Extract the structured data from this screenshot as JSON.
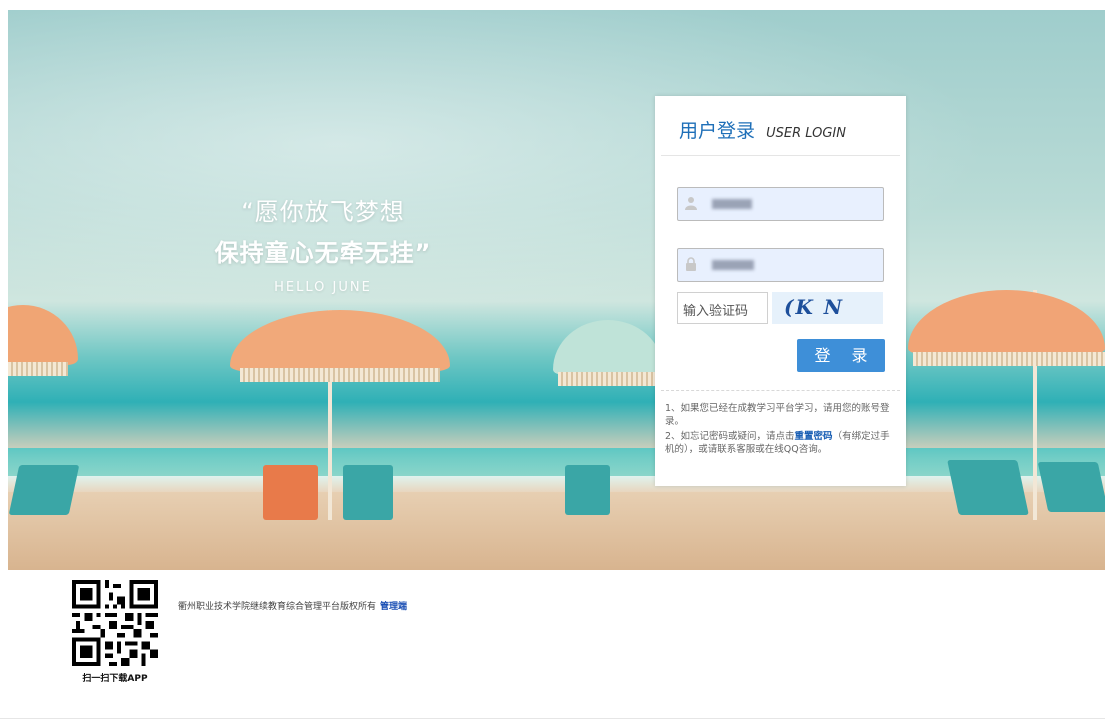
{
  "hero": {
    "quote_line1": "“愿你放飞梦想",
    "quote_line2": "保持童心无牵无挂”",
    "quote_line3": "HELLO JUNE"
  },
  "login": {
    "title": "用户登录",
    "subtitle": "USER LOGIN",
    "username_icon": "user-icon",
    "password_icon": "lock-icon",
    "captcha_placeholder": "输入验证码",
    "captcha_text": "(K N",
    "submit_label": "登 录",
    "tip1": "1、如果您已经在成教学习平台学习，请用您的账号登录。",
    "tip2_before": "2、如忘记密码或疑问，请点击",
    "tip2_link": "重置密码",
    "tip2_after": "（有绑定过手机的），或请联系客服或在线QQ咨询。"
  },
  "footer": {
    "qr_caption": "扫一扫下载APP",
    "copyright": "衢州职业技术学院继续教育综合管理平台版权所有",
    "admin_link": "管理端"
  },
  "colors": {
    "accent": "#1e6fb8",
    "button": "#3e8fd8",
    "field_bg": "#e8f0fe"
  }
}
